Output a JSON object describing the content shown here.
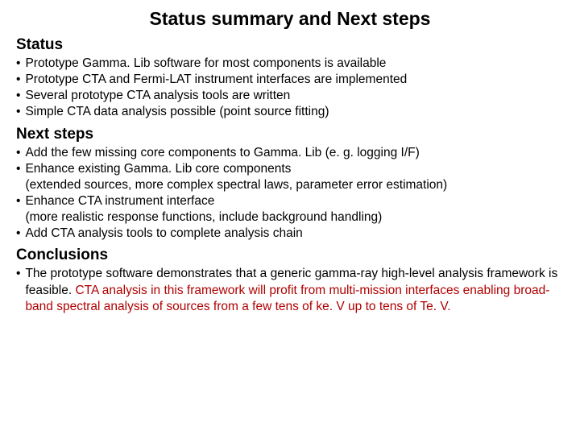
{
  "title": "Status summary and Next steps",
  "sections": {
    "status": {
      "header": "Status",
      "items": [
        "Prototype Gamma. Lib software for most components is available",
        "Prototype CTA and Fermi-LAT instrument interfaces are implemented",
        "Several prototype CTA analysis tools are written",
        "Simple CTA data analysis possible (point source fitting)"
      ]
    },
    "next": {
      "header": "Next steps",
      "items": [
        {
          "main": "Add the few missing core components to Gamma. Lib (e. g. logging I/F)"
        },
        {
          "main": "Enhance existing Gamma. Lib core components",
          "sub": "(extended sources, more complex spectral laws, parameter error estimation)"
        },
        {
          "main": "Enhance CTA instrument interface",
          "sub": "(more realistic response functions, include background handling)"
        },
        {
          "main": "Add CTA analysis tools to complete analysis chain"
        }
      ]
    },
    "conclusions": {
      "header": "Conclusions",
      "item": {
        "pre": "The prototype software demonstrates that a generic gamma-ray high-level analysis framework is feasible. ",
        "red": "CTA analysis in this framework will profit from multi-mission interfaces enabling broad-band spectral analysis of sources from a few tens of ke. V up to tens of Te. V."
      }
    }
  }
}
